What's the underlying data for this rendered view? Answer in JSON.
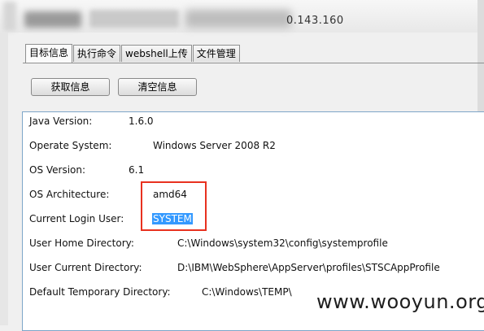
{
  "address": {
    "visible_text": "0.143.160"
  },
  "tabs": [
    {
      "label": "目标信息"
    },
    {
      "label": "执行命令"
    },
    {
      "label": "webshell上传"
    },
    {
      "label": "文件管理"
    }
  ],
  "buttons": {
    "fetch_label": "获取信息",
    "clear_label": "清空信息"
  },
  "info": {
    "rows": [
      {
        "label": "Java Version:",
        "value": "1.6.0"
      },
      {
        "label": "Operate System:",
        "value": "Windows Server 2008 R2"
      },
      {
        "label": "OS Version:",
        "value": "6.1"
      },
      {
        "label": "OS Architecture:",
        "value": "amd64"
      },
      {
        "label": "Current Login User:",
        "value": "SYSTEM"
      },
      {
        "label": "User Home Directory:",
        "value": "C:\\Windows\\system32\\config\\systemprofile"
      },
      {
        "label": "User Current Directory:",
        "value": "D:\\IBM\\WebSphere\\AppServer\\profiles\\STSCAppProfile"
      },
      {
        "label": "Default Temporary Directory:",
        "value": "C:\\Windows\\TEMP\\"
      }
    ]
  },
  "watermark": "www.wooyun.org",
  "colors": {
    "highlight_box": "#e8311f",
    "selection": "#3399ff",
    "panel_border": "#7ea6c8"
  }
}
